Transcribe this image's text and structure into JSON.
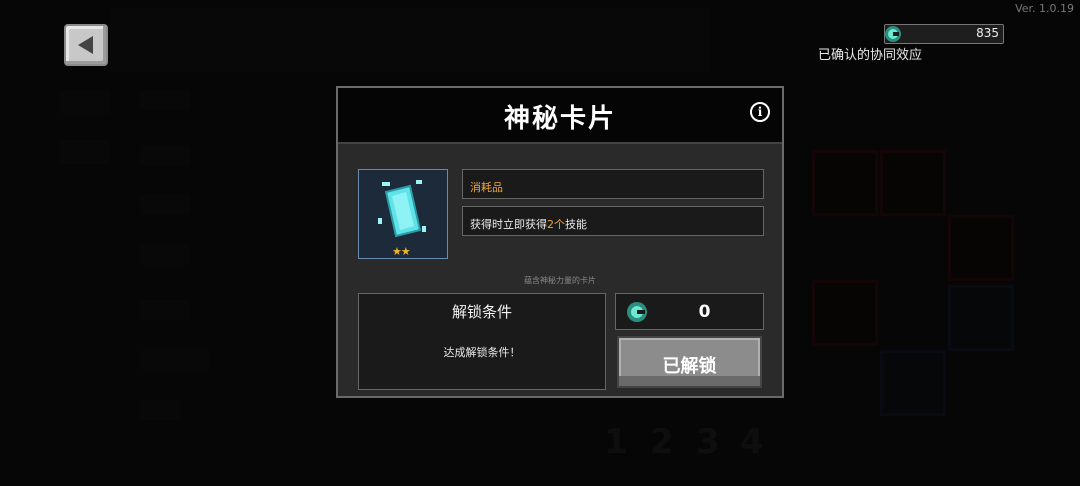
{
  "version": "Ver. 1.0.19",
  "header": {
    "gem_count": "835",
    "synergy_label": "已确认的协同效应"
  },
  "background": {
    "page_numbers": [
      "1",
      "2",
      "3",
      "4"
    ]
  },
  "dialog": {
    "title": "神秘卡片",
    "category": "消耗品",
    "effect_prefix": "获得时立即获得",
    "effect_highlight": "2个",
    "effect_suffix": "技能",
    "stars": "★★",
    "description": "蕴含神秘力量的卡片",
    "unlock_condition_title": "解锁条件",
    "unlock_condition_text": "达成解锁条件！",
    "cost": "0",
    "unlocked_button": "已解锁"
  },
  "colors": {
    "gem": "#3ec9b0",
    "highlight": "#f0a63a",
    "card": "#5fe3e8"
  }
}
